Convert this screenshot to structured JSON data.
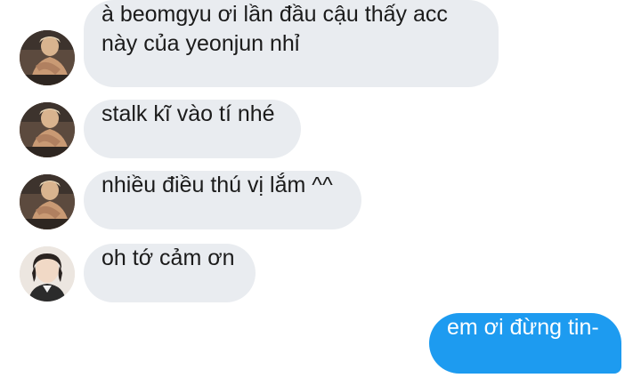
{
  "messages": [
    {
      "sender": "yeonjun",
      "text": "à beomgyu ơi lần đầu cậu thấy acc\nnày của yeonjun nhỉ"
    },
    {
      "sender": "yeonjun",
      "text": "stalk kĩ vào tí nhé"
    },
    {
      "sender": "yeonjun",
      "text": "nhiều điều thú vị lắm ^^"
    },
    {
      "sender": "beomgyu",
      "text": "oh tớ cảm ơn"
    },
    {
      "sender": "me",
      "text": "em ơi đừng tin-"
    }
  ],
  "colors": {
    "incoming_bubble": "#e9ecf0",
    "outgoing_bubble": "#1d9bf0",
    "text": "#1b1b1b"
  }
}
